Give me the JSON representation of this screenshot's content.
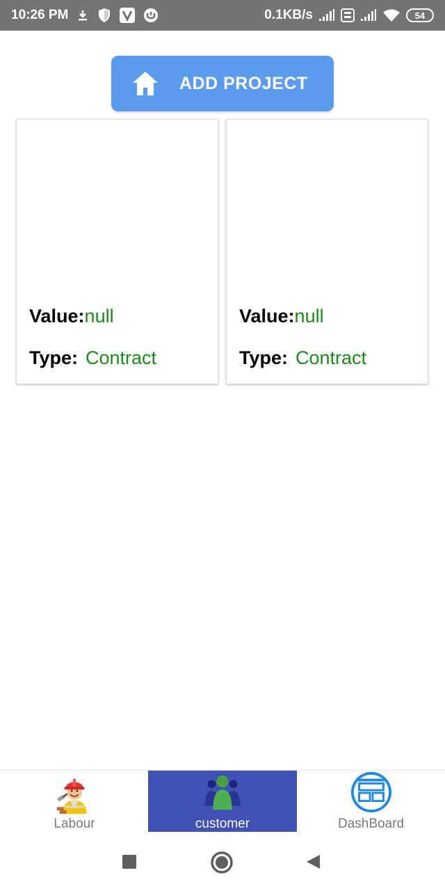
{
  "status_bar": {
    "time": "10:26 PM",
    "net_speed": "0.1KB/s",
    "battery": "54",
    "icons": [
      "download-icon",
      "shield-icon",
      "v-app-icon",
      "torrent-icon",
      "signal-icon",
      "volte-icon",
      "signal-icon-2",
      "wifi-icon",
      "battery-icon"
    ]
  },
  "add_project": {
    "label": "ADD PROJECT",
    "icon": "home-icon",
    "color": "#5b9cee"
  },
  "projects": [
    {
      "value_label": "Value:",
      "value": "null",
      "type_label": "Type:",
      "type": "Contract"
    },
    {
      "value_label": "Value:",
      "value": "null",
      "type_label": "Type:",
      "type": "Contract"
    }
  ],
  "bottom_nav": {
    "items": [
      {
        "label": "Labour",
        "icon": "labour-worker-icon",
        "active": false
      },
      {
        "label": "customer",
        "icon": "customers-group-icon",
        "active": true
      },
      {
        "label": "DashBoard",
        "icon": "dashboard-icon",
        "active": false
      }
    ],
    "active_color": "#3f51b5"
  },
  "system_nav": {
    "buttons": [
      "recents-button",
      "home-button",
      "back-button"
    ]
  },
  "colors": {
    "value_green": "#1a8a1a",
    "status_bar": "#747474"
  }
}
